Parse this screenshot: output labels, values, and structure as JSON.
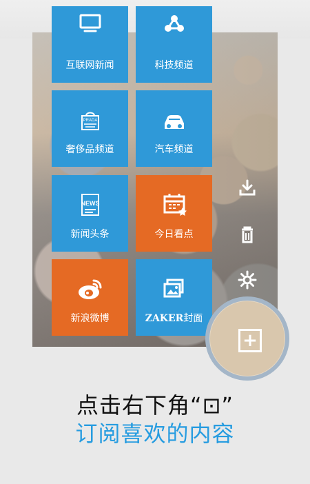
{
  "tiles": [
    {
      "label": "互联网新闻",
      "icon": "monitor-icon",
      "color": "#2f99d8"
    },
    {
      "label": "科技频道",
      "icon": "share-network-icon",
      "color": "#2f99d8"
    },
    {
      "label": "奢侈品频道",
      "icon": "luxury-bag-icon",
      "color": "#2f99d8"
    },
    {
      "label": "汽车频道",
      "icon": "car-icon",
      "color": "#2f99d8"
    },
    {
      "label": "新闻头条",
      "icon": "news-icon",
      "color": "#2f99d8"
    },
    {
      "label": "今日看点",
      "icon": "calendar-star-icon",
      "color": "#e56a24"
    },
    {
      "label": "新浪微博",
      "icon": "weibo-icon",
      "color": "#e56a24"
    },
    {
      "label": "ZAKER封面",
      "icon": "photos-icon",
      "color": "#2f99d8"
    }
  ],
  "icons": {
    "download": "download-icon",
    "trash": "trash-icon",
    "settings": "gear-icon",
    "add": "plus-square-icon"
  },
  "instructions": {
    "line1": "点击右下角“⊡”",
    "line2": "订阅喜欢的内容"
  },
  "colors": {
    "blue": "#2f99d8",
    "orange": "#e56a24",
    "caption_blue": "#269ce0"
  },
  "news_icon_text": "NEWS",
  "zaker_text": "ZAKER"
}
